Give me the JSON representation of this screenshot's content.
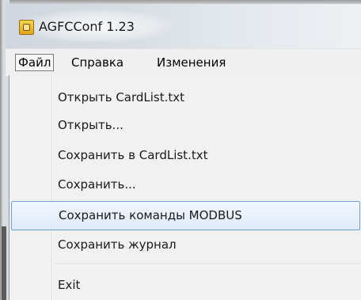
{
  "window": {
    "title": "AGFCConf 1.23",
    "icon": "app-icon"
  },
  "menubar": {
    "items": [
      {
        "label": "Файл",
        "active": true
      },
      {
        "label": "Справка",
        "active": false
      },
      {
        "label": "Изменения",
        "active": false
      }
    ]
  },
  "file_menu": {
    "items": [
      {
        "label": "Открыть CardList.txt"
      },
      {
        "label": "Открыть..."
      },
      {
        "label": "Сохранить в CardList.txt"
      },
      {
        "label": "Сохранить..."
      },
      {
        "label": "Сохранить команды MODBUS",
        "highlighted": true
      },
      {
        "label": "Сохранить журнал"
      },
      {
        "label": "Exit"
      }
    ]
  },
  "colors": {
    "highlight_border": "#6fa0d8",
    "menu_background": "#f1f1f1"
  }
}
